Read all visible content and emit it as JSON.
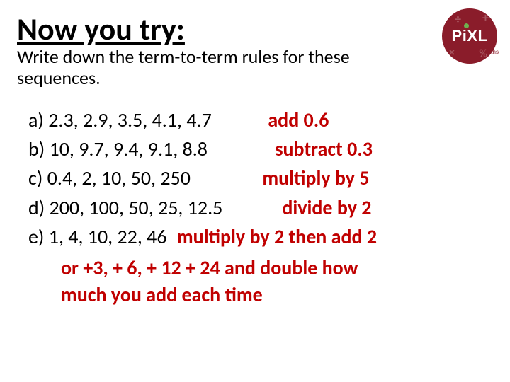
{
  "title": "Now you try:",
  "subtitle": "Write down the term-to-term rules for these sequences.",
  "logo": {
    "text": "PiXL",
    "sub": "maths"
  },
  "items": {
    "a": {
      "sequence": "a) 2.3, 2.9, 3.5, 4.1, 4.7",
      "answer": "add 0.6"
    },
    "b": {
      "sequence": "b) 10, 9.7, 9.4, 9.1, 8.8",
      "answer": "subtract 0.3"
    },
    "c": {
      "sequence": "c) 0.4, 2, 10, 50, 250",
      "answer": "multiply by 5"
    },
    "d": {
      "sequence": "d) 200, 100, 50, 25, 12.5",
      "answer": "divide by 2"
    },
    "e": {
      "sequence": "e) 1, 4, 10, 22, 46",
      "answer": "multiply by 2 then add 2"
    }
  },
  "alt": {
    "line1": "or  +3, + 6, + 12 + 24 and double how",
    "line2": "much you add each time"
  }
}
